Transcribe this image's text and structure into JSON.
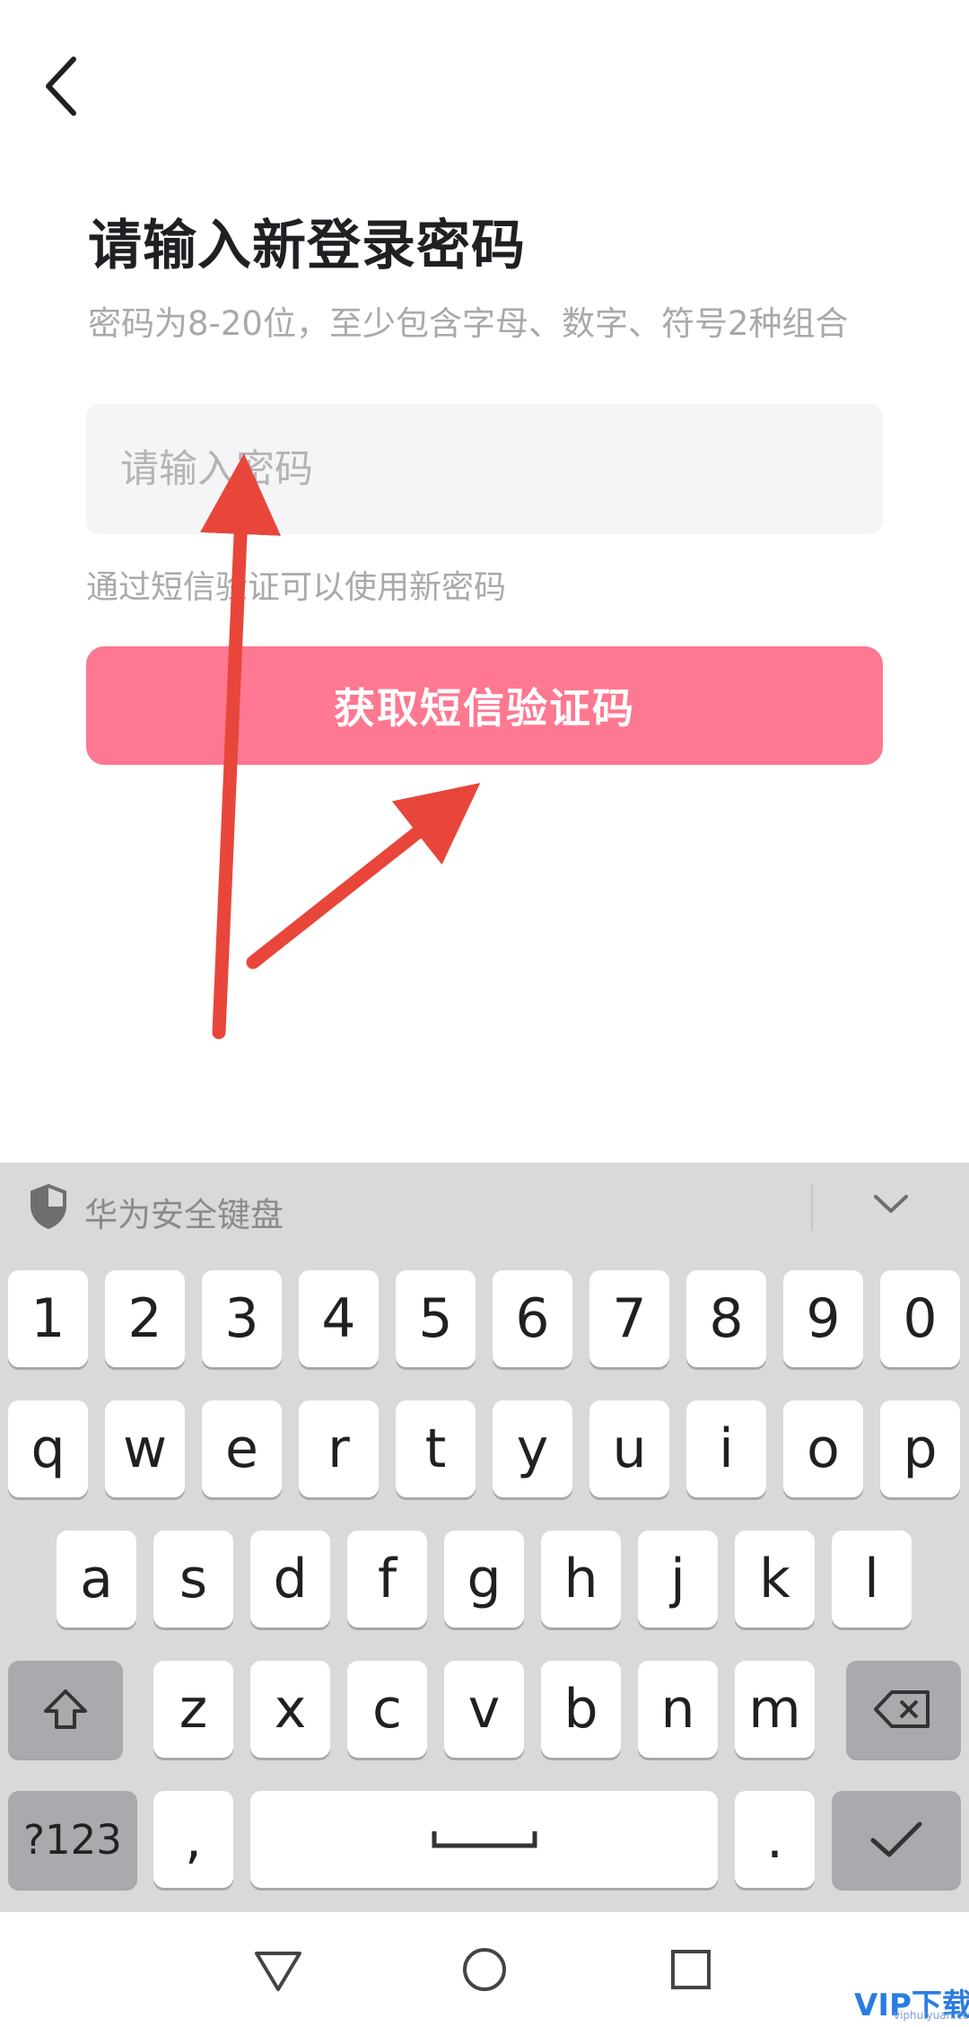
{
  "page": {
    "title": "请输入新登录密码",
    "subtitle": "密码为8-20位，至少包含字母、数字、符号2种组合",
    "password_placeholder": "请输入密码",
    "hint": "通过短信验证可以使用新密码",
    "sms_button_label": "获取短信验证码",
    "accent_color": "#fd7890"
  },
  "keyboard": {
    "title": "华为安全键盘",
    "row_digits": [
      "1",
      "2",
      "3",
      "4",
      "5",
      "6",
      "7",
      "8",
      "9",
      "0"
    ],
    "row_top": [
      "q",
      "w",
      "e",
      "r",
      "t",
      "y",
      "u",
      "i",
      "o",
      "p"
    ],
    "row_mid": [
      "a",
      "s",
      "d",
      "f",
      "g",
      "h",
      "j",
      "k",
      "l"
    ],
    "row_bottom": [
      "z",
      "x",
      "c",
      "v",
      "b",
      "n",
      "m"
    ],
    "sym_label": "?123",
    "comma": ",",
    "period": "."
  },
  "icons": {
    "back": "chevron-left-icon",
    "shield": "shield-icon",
    "collapse": "chevron-down-icon",
    "shift": "shift-icon",
    "backspace": "backspace-icon",
    "space": "space-icon",
    "enter": "check-icon",
    "nav_back": "triangle-back-icon",
    "nav_home": "circle-home-icon",
    "nav_recent": "square-recent-icon"
  },
  "watermark": {
    "brand": "VIP下载",
    "site": "viphuiyuan.cc"
  }
}
